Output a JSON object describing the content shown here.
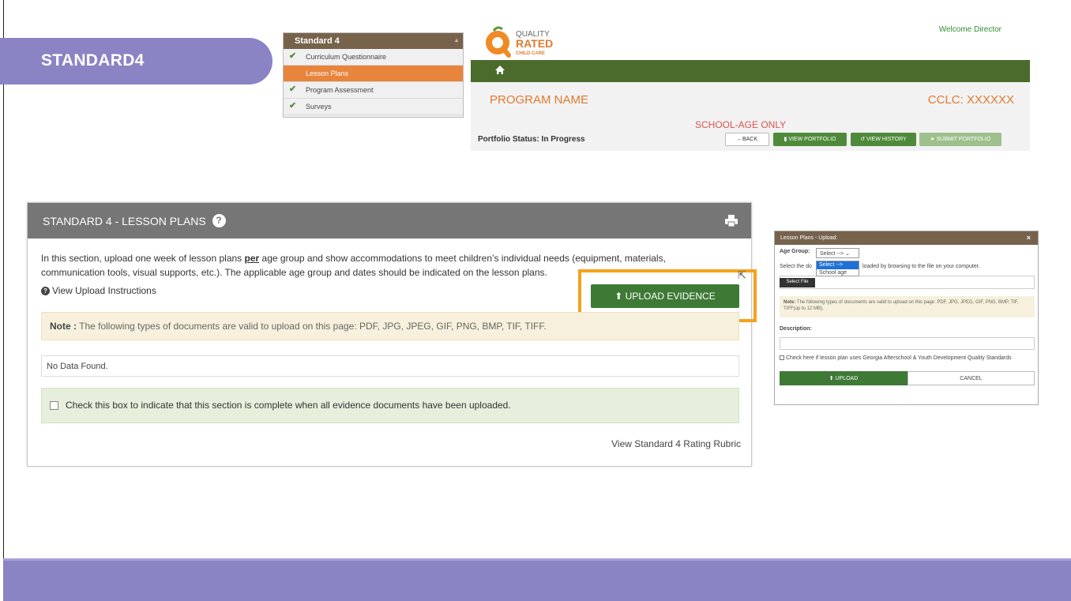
{
  "slide": {
    "title": "STANDARD4"
  },
  "menu": {
    "header": "Standard 4",
    "items": [
      {
        "label": "Curriculum Questionnaire",
        "checked": true,
        "active": false
      },
      {
        "label": "Lesson Plans",
        "checked": false,
        "active": true
      },
      {
        "label": "Program Assessment",
        "checked": true,
        "active": false
      },
      {
        "label": "Surveys",
        "checked": true,
        "active": false
      }
    ]
  },
  "header": {
    "logo": {
      "line1": "QUALITY",
      "line2": "RATED",
      "line3": "CHILD CARE"
    },
    "welcome": "Welcome Director",
    "program_name": "PROGRAM NAME",
    "cclc": "CCLC: XXXXXX",
    "age_note": "SCHOOL-AGE ONLY",
    "portfolio_status": "Portfolio Status: In Progress",
    "buttons": {
      "back": "BACK",
      "view_portfolio": "VIEW PORTFOLIO",
      "view_history": "VIEW HISTORY",
      "submit_portfolio": "SUBMIT PORTFOLIO"
    },
    "colors": {
      "green": "#4a6b2c",
      "orange": "#e07a2e"
    }
  },
  "main": {
    "title": "STANDARD 4 - LESSON PLANS",
    "intro_before": "In this section, upload one week of lesson plans ",
    "intro_bold": "per",
    "intro_after": " age group and show accommodations to meet children’s individual needs (equipment, materials, communication tools, visual supports, etc.). The applicable age group and dates should be indicated on the lesson plans.",
    "view_instructions": "View Upload Instructions",
    "upload_button": "UPLOAD EVIDENCE",
    "note_label": "Note :",
    "note_text": " The following types of documents are valid to upload on this page: PDF, JPG, JPEG, GIF, PNG, BMP, TIF, TIFF.",
    "no_data": "No Data Found.",
    "complete_label": "Check this box to indicate that this section is complete when all evidence documents have been uploaded.",
    "rubric_link": "View Standard 4 Rating Rubric"
  },
  "modal": {
    "title": "Lesson Plans - Upload:",
    "age_group_label": "Age Group:",
    "select_value": "Select -->",
    "options": [
      "Select -->",
      "School age"
    ],
    "select_desc_a": "Select the do",
    "select_desc_b": "loaded by browsing to the file on your computer.",
    "select_file": "Select File",
    "note_label": "Note:",
    "note_text": " The following types of documents are valid to upload on this page: PDF, JPG, JPEG, GIF, PNG, BMP, TIF, TIFF(up to 12 MB).",
    "description_label": "Description:",
    "check_label": "Check here if lesson plan uses Georgia Afterschool & Youth Development Quality Standards",
    "upload_button": "UPLOAD",
    "cancel_button": "CANCEL"
  }
}
